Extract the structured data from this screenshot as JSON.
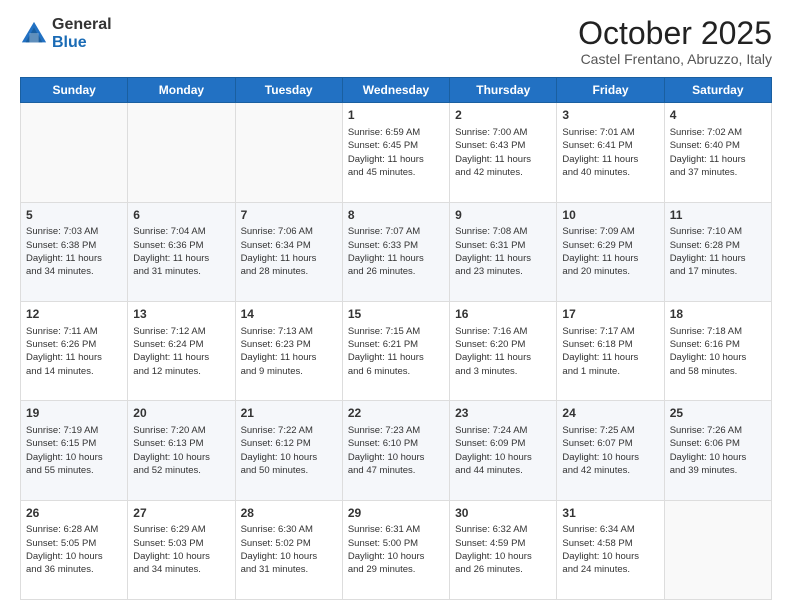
{
  "logo": {
    "general": "General",
    "blue": "Blue"
  },
  "title": "October 2025",
  "subtitle": "Castel Frentano, Abruzzo, Italy",
  "days": [
    "Sunday",
    "Monday",
    "Tuesday",
    "Wednesday",
    "Thursday",
    "Friday",
    "Saturday"
  ],
  "weeks": [
    [
      {
        "day": "",
        "content": ""
      },
      {
        "day": "",
        "content": ""
      },
      {
        "day": "",
        "content": ""
      },
      {
        "day": "1",
        "content": "Sunrise: 6:59 AM\nSunset: 6:45 PM\nDaylight: 11 hours\nand 45 minutes."
      },
      {
        "day": "2",
        "content": "Sunrise: 7:00 AM\nSunset: 6:43 PM\nDaylight: 11 hours\nand 42 minutes."
      },
      {
        "day": "3",
        "content": "Sunrise: 7:01 AM\nSunset: 6:41 PM\nDaylight: 11 hours\nand 40 minutes."
      },
      {
        "day": "4",
        "content": "Sunrise: 7:02 AM\nSunset: 6:40 PM\nDaylight: 11 hours\nand 37 minutes."
      }
    ],
    [
      {
        "day": "5",
        "content": "Sunrise: 7:03 AM\nSunset: 6:38 PM\nDaylight: 11 hours\nand 34 minutes."
      },
      {
        "day": "6",
        "content": "Sunrise: 7:04 AM\nSunset: 6:36 PM\nDaylight: 11 hours\nand 31 minutes."
      },
      {
        "day": "7",
        "content": "Sunrise: 7:06 AM\nSunset: 6:34 PM\nDaylight: 11 hours\nand 28 minutes."
      },
      {
        "day": "8",
        "content": "Sunrise: 7:07 AM\nSunset: 6:33 PM\nDaylight: 11 hours\nand 26 minutes."
      },
      {
        "day": "9",
        "content": "Sunrise: 7:08 AM\nSunset: 6:31 PM\nDaylight: 11 hours\nand 23 minutes."
      },
      {
        "day": "10",
        "content": "Sunrise: 7:09 AM\nSunset: 6:29 PM\nDaylight: 11 hours\nand 20 minutes."
      },
      {
        "day": "11",
        "content": "Sunrise: 7:10 AM\nSunset: 6:28 PM\nDaylight: 11 hours\nand 17 minutes."
      }
    ],
    [
      {
        "day": "12",
        "content": "Sunrise: 7:11 AM\nSunset: 6:26 PM\nDaylight: 11 hours\nand 14 minutes."
      },
      {
        "day": "13",
        "content": "Sunrise: 7:12 AM\nSunset: 6:24 PM\nDaylight: 11 hours\nand 12 minutes."
      },
      {
        "day": "14",
        "content": "Sunrise: 7:13 AM\nSunset: 6:23 PM\nDaylight: 11 hours\nand 9 minutes."
      },
      {
        "day": "15",
        "content": "Sunrise: 7:15 AM\nSunset: 6:21 PM\nDaylight: 11 hours\nand 6 minutes."
      },
      {
        "day": "16",
        "content": "Sunrise: 7:16 AM\nSunset: 6:20 PM\nDaylight: 11 hours\nand 3 minutes."
      },
      {
        "day": "17",
        "content": "Sunrise: 7:17 AM\nSunset: 6:18 PM\nDaylight: 11 hours\nand 1 minute."
      },
      {
        "day": "18",
        "content": "Sunrise: 7:18 AM\nSunset: 6:16 PM\nDaylight: 10 hours\nand 58 minutes."
      }
    ],
    [
      {
        "day": "19",
        "content": "Sunrise: 7:19 AM\nSunset: 6:15 PM\nDaylight: 10 hours\nand 55 minutes."
      },
      {
        "day": "20",
        "content": "Sunrise: 7:20 AM\nSunset: 6:13 PM\nDaylight: 10 hours\nand 52 minutes."
      },
      {
        "day": "21",
        "content": "Sunrise: 7:22 AM\nSunset: 6:12 PM\nDaylight: 10 hours\nand 50 minutes."
      },
      {
        "day": "22",
        "content": "Sunrise: 7:23 AM\nSunset: 6:10 PM\nDaylight: 10 hours\nand 47 minutes."
      },
      {
        "day": "23",
        "content": "Sunrise: 7:24 AM\nSunset: 6:09 PM\nDaylight: 10 hours\nand 44 minutes."
      },
      {
        "day": "24",
        "content": "Sunrise: 7:25 AM\nSunset: 6:07 PM\nDaylight: 10 hours\nand 42 minutes."
      },
      {
        "day": "25",
        "content": "Sunrise: 7:26 AM\nSunset: 6:06 PM\nDaylight: 10 hours\nand 39 minutes."
      }
    ],
    [
      {
        "day": "26",
        "content": "Sunrise: 6:28 AM\nSunset: 5:05 PM\nDaylight: 10 hours\nand 36 minutes."
      },
      {
        "day": "27",
        "content": "Sunrise: 6:29 AM\nSunset: 5:03 PM\nDaylight: 10 hours\nand 34 minutes."
      },
      {
        "day": "28",
        "content": "Sunrise: 6:30 AM\nSunset: 5:02 PM\nDaylight: 10 hours\nand 31 minutes."
      },
      {
        "day": "29",
        "content": "Sunrise: 6:31 AM\nSunset: 5:00 PM\nDaylight: 10 hours\nand 29 minutes."
      },
      {
        "day": "30",
        "content": "Sunrise: 6:32 AM\nSunset: 4:59 PM\nDaylight: 10 hours\nand 26 minutes."
      },
      {
        "day": "31",
        "content": "Sunrise: 6:34 AM\nSunset: 4:58 PM\nDaylight: 10 hours\nand 24 minutes."
      },
      {
        "day": "",
        "content": ""
      }
    ]
  ]
}
